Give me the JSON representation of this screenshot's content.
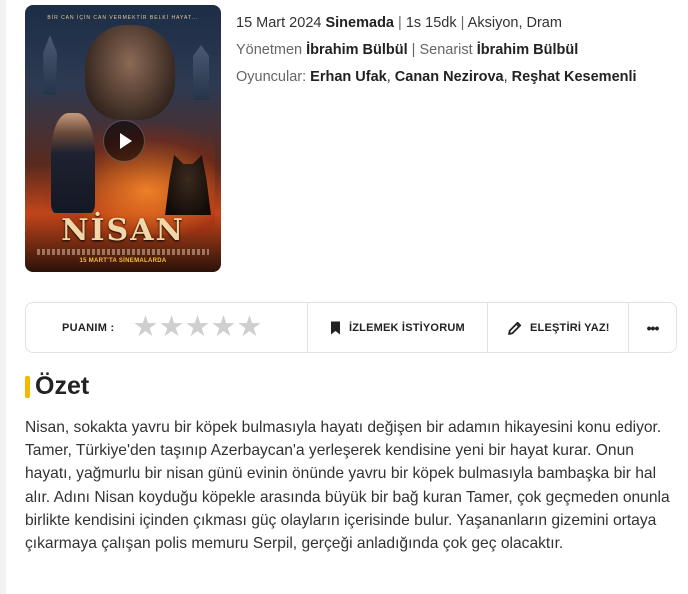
{
  "movie": {
    "poster": {
      "tagline": "BİR CAN İÇİN CAN VERMEKTİR BELKİ HAYAT...",
      "title": "NİSAN",
      "release_banner": "15 MART'TA SİNEMALARDA"
    },
    "release_date": "15 Mart 2024",
    "release_venue": "Sinemada",
    "duration": "1s 15dk",
    "genres": "Aksiyon, Dram",
    "director_label": "Yönetmen",
    "director": "İbrahim Bülbül",
    "writer_label": "Senarist",
    "writer": "İbrahim Bülbül",
    "cast_label": "Oyuncular:",
    "cast": [
      "Erhan Ufak",
      "Canan Nezirova",
      "Reşhat Kesemenli"
    ]
  },
  "actions": {
    "rating_label": "PUANIM :",
    "stars_total": 5,
    "stars_selected": 0,
    "watchlist_label": "İZLEMEK İSTİYORUM",
    "review_label": "ELEŞTİRİ YAZ!",
    "more_label": "•••"
  },
  "summary": {
    "title": "Özet",
    "text": "Nisan, sokakta yavru bir köpek bulmasıyla hayatı değişen bir adamın hikayesini konu ediyor. Tamer, Türkiye'den taşınıp Azerbaycan'a yerleşerek kendisine yeni bir hayat kurar. Onun hayatı, yağmurlu bir nisan günü evinin önünde yavru bir köpek bulmasıyla bambaşka bir hal alır. Adını Nisan koyduğu köpekle arasında büyük bir bağ kuran Tamer, çok geçmeden onunla birlikte kendisini içinden çıkması güç olayların içerisinde bulur. Yaşananların gizemini ortaya çıkarmaya çalışan polis memuru Serpil, gerçeği anladığında çok geç olacaktır."
  },
  "colors": {
    "accent": "#f5b800",
    "star_empty": "#cfcfcf",
    "border": "#e2e2e2",
    "text": "#333333"
  }
}
